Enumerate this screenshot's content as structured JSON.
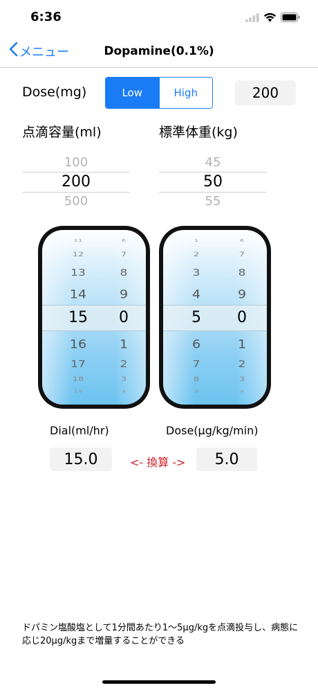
{
  "status": {
    "time": "6:36"
  },
  "nav": {
    "back_label": "メニュー",
    "title": "Dopamine(0.1%)"
  },
  "dose": {
    "label": "Dose(mg)",
    "low_label": "Low",
    "high_label": "High",
    "value": "200"
  },
  "volume_picker": {
    "label": "点滴容量(ml)",
    "above": "100",
    "selected": "200",
    "below": "500"
  },
  "weight_picker": {
    "label": "標準体重(kg)",
    "above": "45",
    "selected": "50",
    "below": "55"
  },
  "dial_drum": {
    "left_digits": [
      "11",
      "12",
      "13",
      "14",
      "15",
      "16",
      "17",
      "18",
      "19"
    ],
    "right_digits": [
      "6",
      "7",
      "8",
      "9",
      "0",
      "1",
      "2",
      "3",
      "4"
    ]
  },
  "dose_drum": {
    "left_digits": [
      "1",
      "2",
      "3",
      "4",
      "5",
      "6",
      "7",
      "8",
      "9"
    ],
    "right_digits": [
      "6",
      "7",
      "8",
      "9",
      "0",
      "1",
      "2",
      "3",
      "4"
    ]
  },
  "conversion": {
    "dial_label": "Dial(ml/hr)",
    "dose_label": "Dose(μg/kg/min)",
    "rate_value": "15.0",
    "arrow_label": "<- 換算 ->",
    "dose_value": "5.0"
  },
  "note": "ドパミン塩酸塩として1分間あたり1〜5μg/kgを点滴投与し、病態に応じ20μg/kgまで増量することができる"
}
